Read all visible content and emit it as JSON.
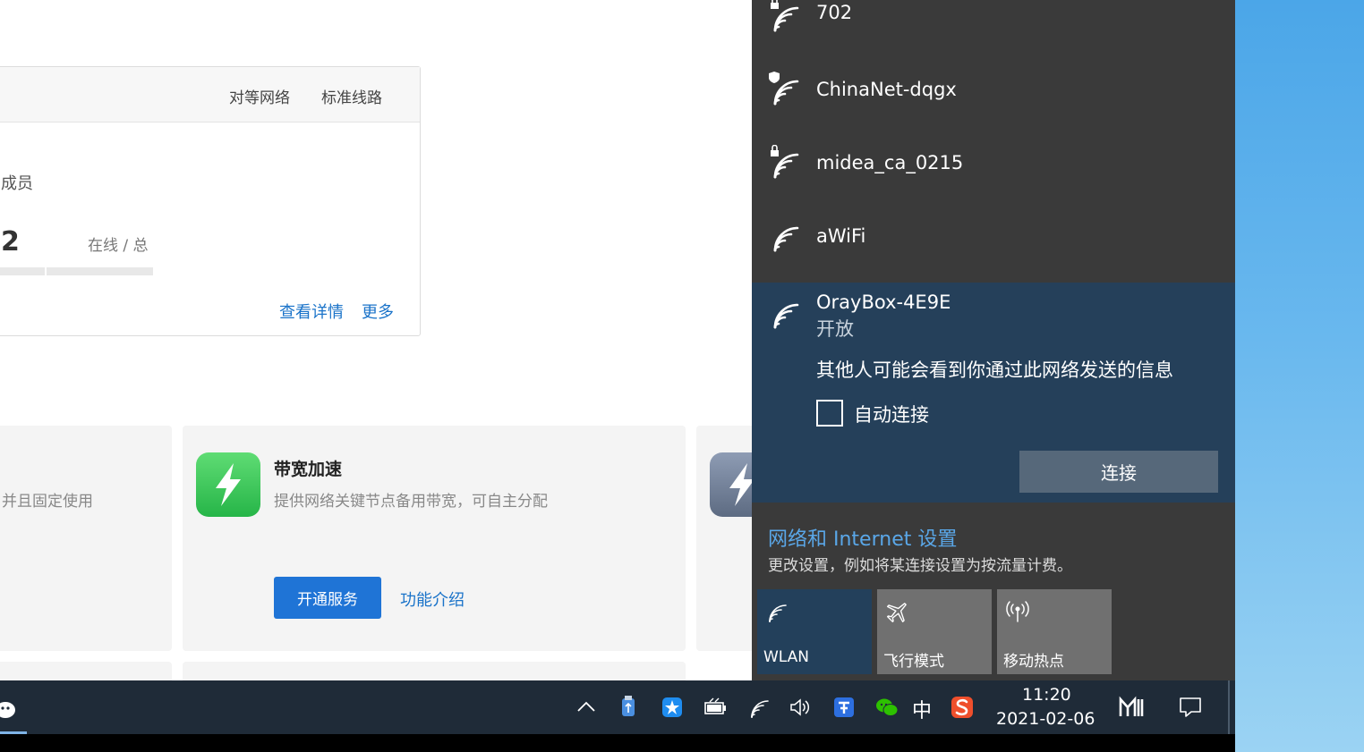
{
  "background_page": {
    "card": {
      "tabs": [
        "对等网络",
        "标准线路"
      ],
      "members_label": "成员",
      "members_count": "2",
      "online_label": "在线 / 总",
      "links": [
        "查看详情",
        "更多"
      ]
    },
    "tiles": [
      {
        "desc": "并且固定使用"
      },
      {
        "title": "带宽加速",
        "desc": "提供网络关键节点备用带宽，可自主分配",
        "primary_button": "开通服务",
        "link": "功能介绍",
        "icon": "lightning-icon"
      },
      {
        "icon": "lightning-icon"
      }
    ]
  },
  "flyout": {
    "networks": [
      {
        "name": "702",
        "icon": "wifi-secured-icon"
      },
      {
        "name": "ChinaNet-dqgx",
        "icon": "wifi-shield-icon"
      },
      {
        "name": "midea_ca_0215",
        "icon": "wifi-secured-icon"
      },
      {
        "name": "aWiFi",
        "icon": "wifi-icon"
      }
    ],
    "selected": {
      "name": "OrayBox-4E9E",
      "status": "开放",
      "warning": "其他人可能会看到你通过此网络发送的信息",
      "auto_connect_label": "自动连接",
      "auto_connect_checked": false,
      "connect_button": "连接"
    },
    "settings_link": "网络和 Internet 设置",
    "settings_sub": "更改设置，例如将某连接设置为按流量计费。",
    "quick_actions": [
      {
        "label": "WLAN",
        "icon": "wifi-icon",
        "active": true
      },
      {
        "label": "飞行模式",
        "icon": "airplane-icon",
        "active": false
      },
      {
        "label": "移动热点",
        "icon": "hotspot-icon",
        "active": false
      }
    ]
  },
  "taskbar": {
    "ime": "中",
    "time": "11:20",
    "date": "2021-02-06"
  },
  "colors": {
    "flyout_bg": "#3a3a3a",
    "selected_bg": "#25405a",
    "accent_link": "#5aa7e8",
    "taskbar_bg": "#1f2b38",
    "primary_button": "#1f74d6"
  }
}
